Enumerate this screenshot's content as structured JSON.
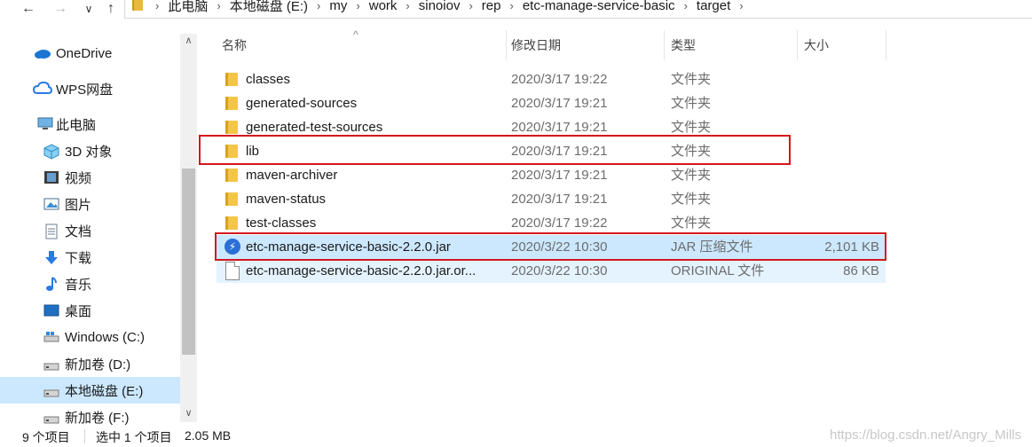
{
  "address_bar": {
    "back": "←",
    "forward": "→",
    "recent": "∨",
    "up": "↑",
    "crumbs": [
      "此电脑",
      "本地磁盘 (E:)",
      "my",
      "work",
      "sinoiov",
      "rep",
      "etc-manage-service-basic",
      "target"
    ],
    "separator": "›"
  },
  "nav_pane": {
    "items": [
      {
        "label": "OneDrive",
        "icon": "onedrive-cloud-icon"
      },
      {
        "label": "WPS网盘",
        "icon": "wps-cloud-icon"
      },
      {
        "label": "此电脑",
        "icon": "this-pc-icon"
      },
      {
        "label": "3D 对象",
        "icon": "3d-objects-icon"
      },
      {
        "label": "视频",
        "icon": "video-icon"
      },
      {
        "label": "图片",
        "icon": "pictures-icon"
      },
      {
        "label": "文档",
        "icon": "documents-icon"
      },
      {
        "label": "下载",
        "icon": "download-icon"
      },
      {
        "label": "音乐",
        "icon": "music-icon"
      },
      {
        "label": "桌面",
        "icon": "desktop-icon"
      },
      {
        "label": "Windows (C:)",
        "icon": "windows-drive-icon"
      },
      {
        "label": "新加卷 (D:)",
        "icon": "drive-icon"
      },
      {
        "label": "本地磁盘 (E:)",
        "icon": "drive-icon"
      },
      {
        "label": "新加卷 (F:)",
        "icon": "drive-icon"
      }
    ],
    "selected": "本地磁盘 (E:)",
    "scroll_up": "∧",
    "scroll_down": "∨"
  },
  "file_list": {
    "columns": {
      "name": "名称",
      "date": "修改日期",
      "type": "类型",
      "size": "大小"
    },
    "sort_indicator": "^",
    "rows": [
      {
        "name": "classes",
        "date": "2020/3/17 19:22",
        "type": "文件夹",
        "size": "",
        "icon": "folder-icon"
      },
      {
        "name": "generated-sources",
        "date": "2020/3/17 19:21",
        "type": "文件夹",
        "size": "",
        "icon": "folder-icon"
      },
      {
        "name": "generated-test-sources",
        "date": "2020/3/17 19:21",
        "type": "文件夹",
        "size": "",
        "icon": "folder-icon"
      },
      {
        "name": "lib",
        "date": "2020/3/17 19:21",
        "type": "文件夹",
        "size": "",
        "icon": "folder-icon"
      },
      {
        "name": "maven-archiver",
        "date": "2020/3/17 19:21",
        "type": "文件夹",
        "size": "",
        "icon": "folder-icon"
      },
      {
        "name": "maven-status",
        "date": "2020/3/17 19:21",
        "type": "文件夹",
        "size": "",
        "icon": "folder-icon"
      },
      {
        "name": "test-classes",
        "date": "2020/3/17 19:22",
        "type": "文件夹",
        "size": "",
        "icon": "folder-icon"
      },
      {
        "name": "etc-manage-service-basic-2.2.0.jar",
        "date": "2020/3/22 10:30",
        "type": "JAR 压缩文件",
        "size": "2,101 KB",
        "icon": "jar-file-icon"
      },
      {
        "name": "etc-manage-service-basic-2.2.0.jar.or...",
        "date": "2020/3/22 10:30",
        "type": "ORIGINAL 文件",
        "size": "86 KB",
        "icon": "generic-file-icon"
      }
    ]
  },
  "status_bar": {
    "item_count": "9 个项目",
    "selection": "选中 1 个项目",
    "selection_size": "2.05 MB"
  },
  "watermark": "https://blog.csdn.net/Angry_Mills",
  "colors": {
    "selection": "#cce8ff",
    "hover": "#e5f3ff",
    "highlight_box": "#d4161d",
    "folder": "#f3c54a"
  }
}
